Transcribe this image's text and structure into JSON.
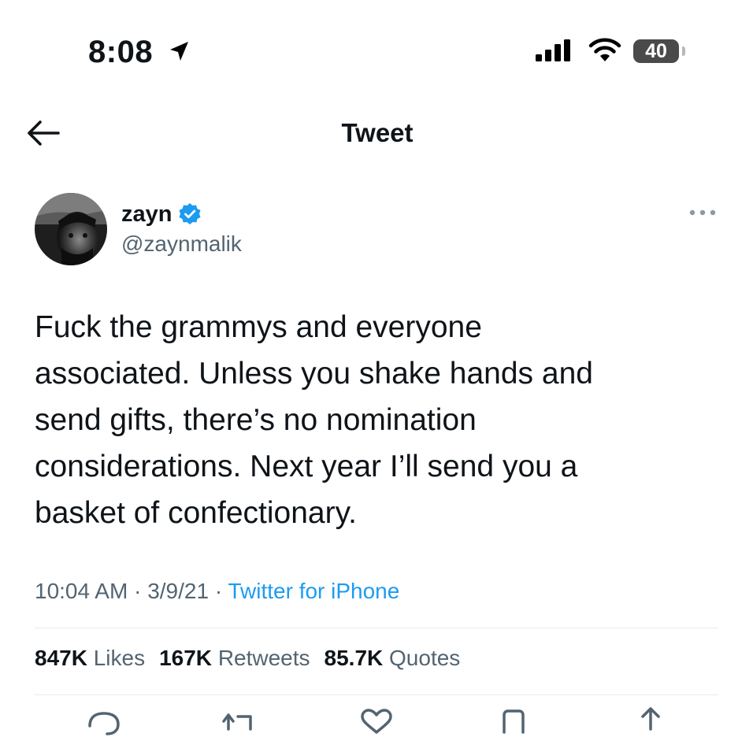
{
  "status_bar": {
    "time": "8:08",
    "battery_level": "40",
    "icons": [
      "location-arrow-icon",
      "signal-icon",
      "wifi-icon",
      "battery-icon"
    ]
  },
  "nav": {
    "title": "Tweet",
    "back_icon": "back-arrow-icon"
  },
  "tweet": {
    "display_name": "zayn",
    "handle": "@zaynmalik",
    "verified": true,
    "text_lines": [
      "Fuck the grammys and everyone",
      "associated. Unless you shake hands and",
      "send gifts, there’s no nomination",
      "considerations. Next year I’ll send you a",
      "basket of confectionary."
    ],
    "time": "10:04 AM",
    "date": "3/9/21",
    "separator": " · ",
    "source": "Twitter for iPhone"
  },
  "stats": {
    "likes_count": "847K",
    "likes_label": "Likes",
    "retweets_count": "167K",
    "retweets_label": "Retweets",
    "quotes_count": "85.7K",
    "quotes_label": "Quotes"
  },
  "actions": [
    "reply-icon",
    "retweet-icon",
    "like-icon",
    "bookmark-icon",
    "share-icon"
  ],
  "colors": {
    "accent": "#1d9bf0",
    "secondary_text": "#536471",
    "primary_text": "#0f1419"
  }
}
